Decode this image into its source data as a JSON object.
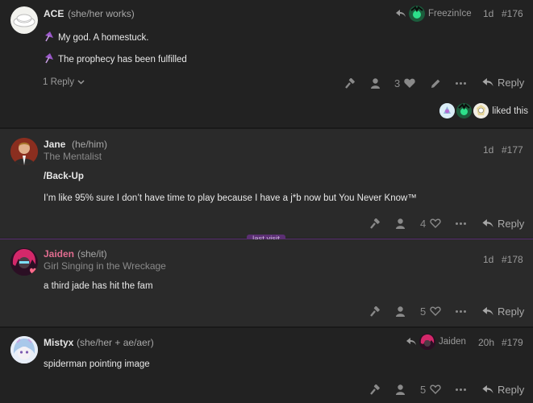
{
  "posts": [
    {
      "username": "ACE",
      "pronouns": "(she/her works)",
      "reply_to": "FreezinIce",
      "date": "1d",
      "number": "#176",
      "lines": [
        "My god. A homestuck.",
        "The prophecy has been fulfilled"
      ],
      "line_icon": "umbrella-icon",
      "replies_label": "1 Reply",
      "likes": "3",
      "reply_label": "Reply",
      "liked_text": "liked this"
    },
    {
      "username": "Jane",
      "pronouns": "(he/him)",
      "user_title": "The Mentalist",
      "date": "1d",
      "number": "#177",
      "lines": [
        "/Back-Up",
        "I’m like 95% sure I don’t have time to play because I have a j*b now but You Never Know™"
      ],
      "likes": "4",
      "reply_label": "Reply"
    },
    {
      "username": "Jaiden",
      "pronouns": "(she/it)",
      "user_title": "Girl Singing in the Wreckage",
      "date": "1d",
      "number": "#178",
      "lines": [
        "a third jade has hit the fam"
      ],
      "likes": "5",
      "reply_label": "Reply"
    },
    {
      "username": "Mistyx",
      "pronouns": "(she/her + ae/aer)",
      "reply_to": "Jaiden",
      "date": "20h",
      "number": "#179",
      "lines": [
        "spiderman pointing image"
      ],
      "likes": "5",
      "reply_label": "Reply"
    }
  ],
  "last_visit_label": "last visit",
  "colors": {
    "accent_purple": "#5b2f73",
    "username_pink": "#e06c8f"
  }
}
